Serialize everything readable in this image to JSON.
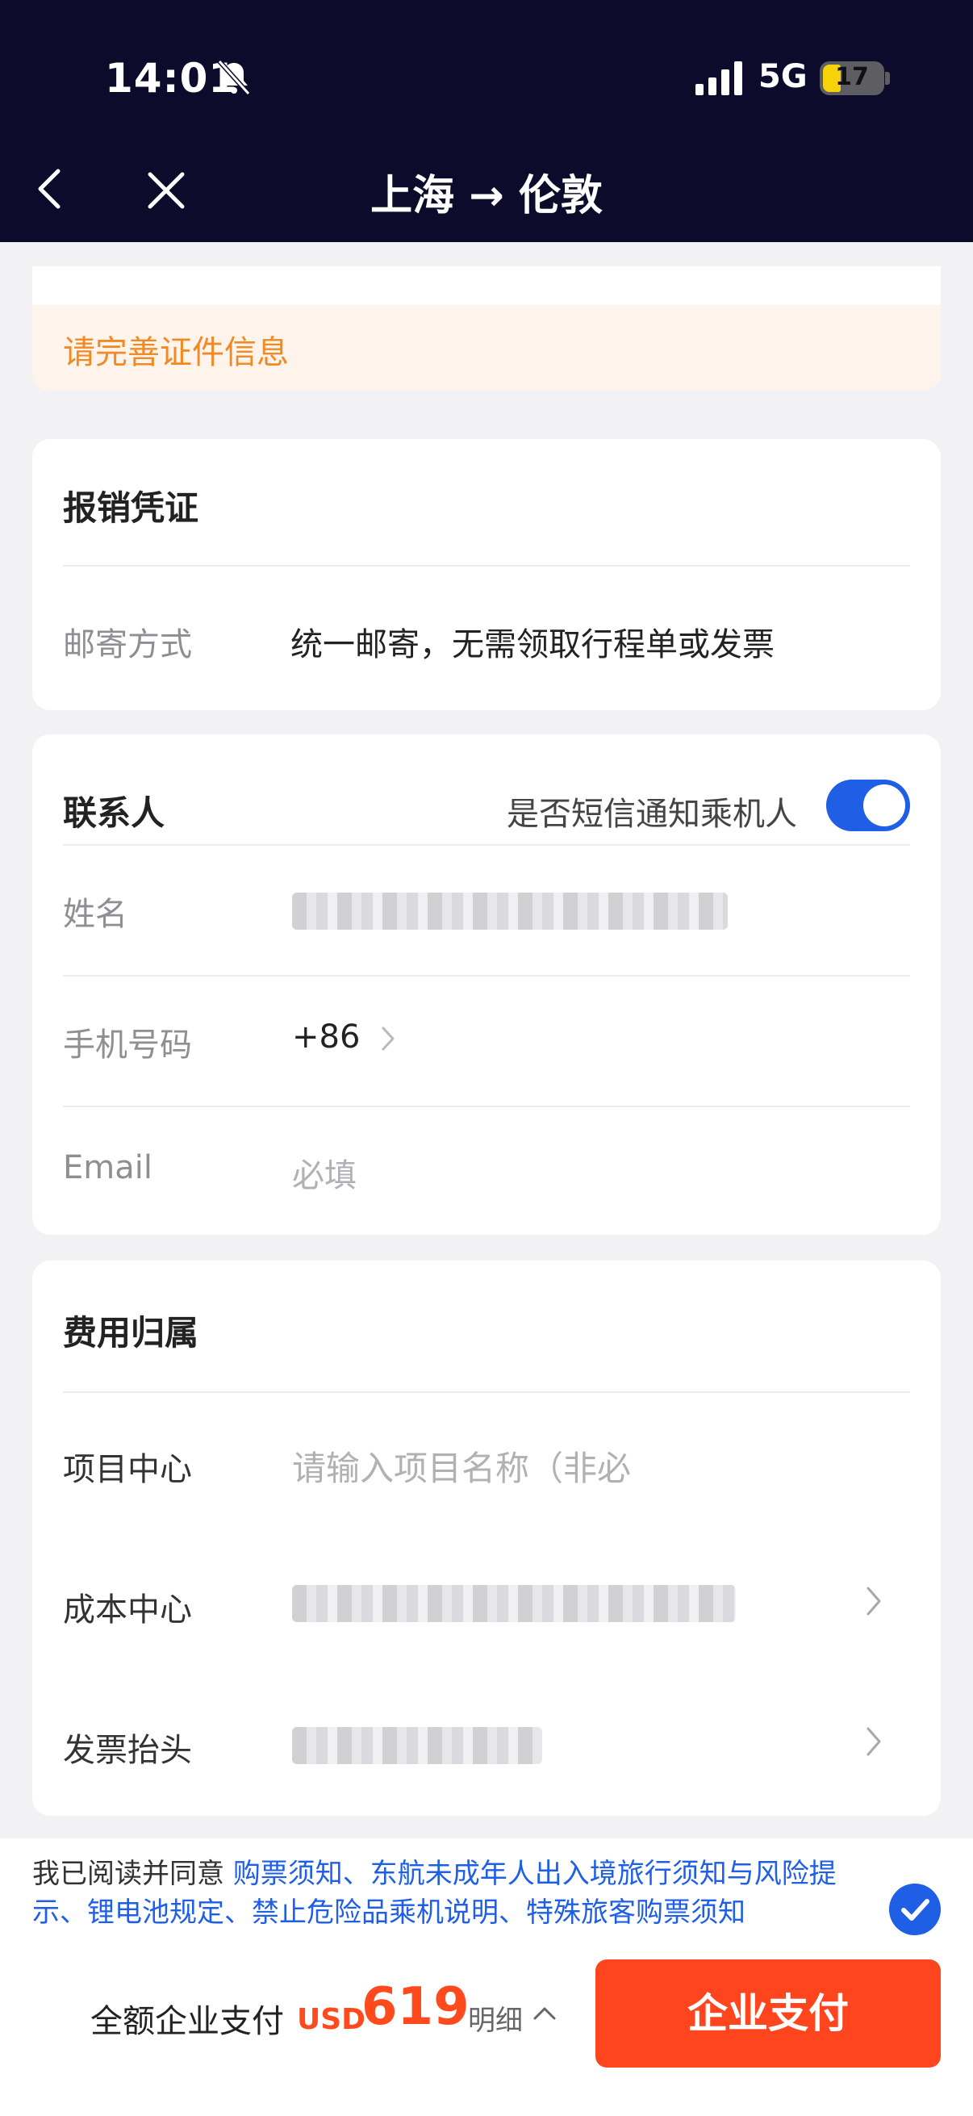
{
  "status_bar": {
    "time": "14:01",
    "network": "5G",
    "battery": "17"
  },
  "header": {
    "route_title": "上海 → 伦敦"
  },
  "notice": {
    "text": "请完善证件信息"
  },
  "reimbursement": {
    "title": "报销凭证",
    "mail_label": "邮寄方式",
    "mail_value": "统一邮寄，无需领取行程单或发票"
  },
  "contact": {
    "title": "联系人",
    "sms_label": "是否短信通知乘机人",
    "sms_enabled": true,
    "name_label": "姓名",
    "phone_label": "手机号码",
    "phone_prefix": "+86",
    "email_label": "Email",
    "email_placeholder": "必填"
  },
  "expense": {
    "title": "费用归属",
    "project_label": "项目中心",
    "project_placeholder": "请输入项目名称（非必",
    "cost_label": "成本中心",
    "invoice_label": "发票抬头"
  },
  "agreement": {
    "prefix": "我已阅读并同意 ",
    "links": "购票须知、东航未成年人出入境旅行须知与风险提示、锂电池规定、禁止危险品乘机说明、特殊旅客购票须知",
    "checked": true
  },
  "footer": {
    "pay_mode": "全额企业支付",
    "currency": "USD",
    "amount": "619",
    "detail_label": "明细",
    "pay_button": "企业支付"
  },
  "colors": {
    "accent": "#1e5fe6",
    "pay": "#ff451d",
    "header_bg": "#0d0b2b",
    "warning": "#f08a24"
  }
}
